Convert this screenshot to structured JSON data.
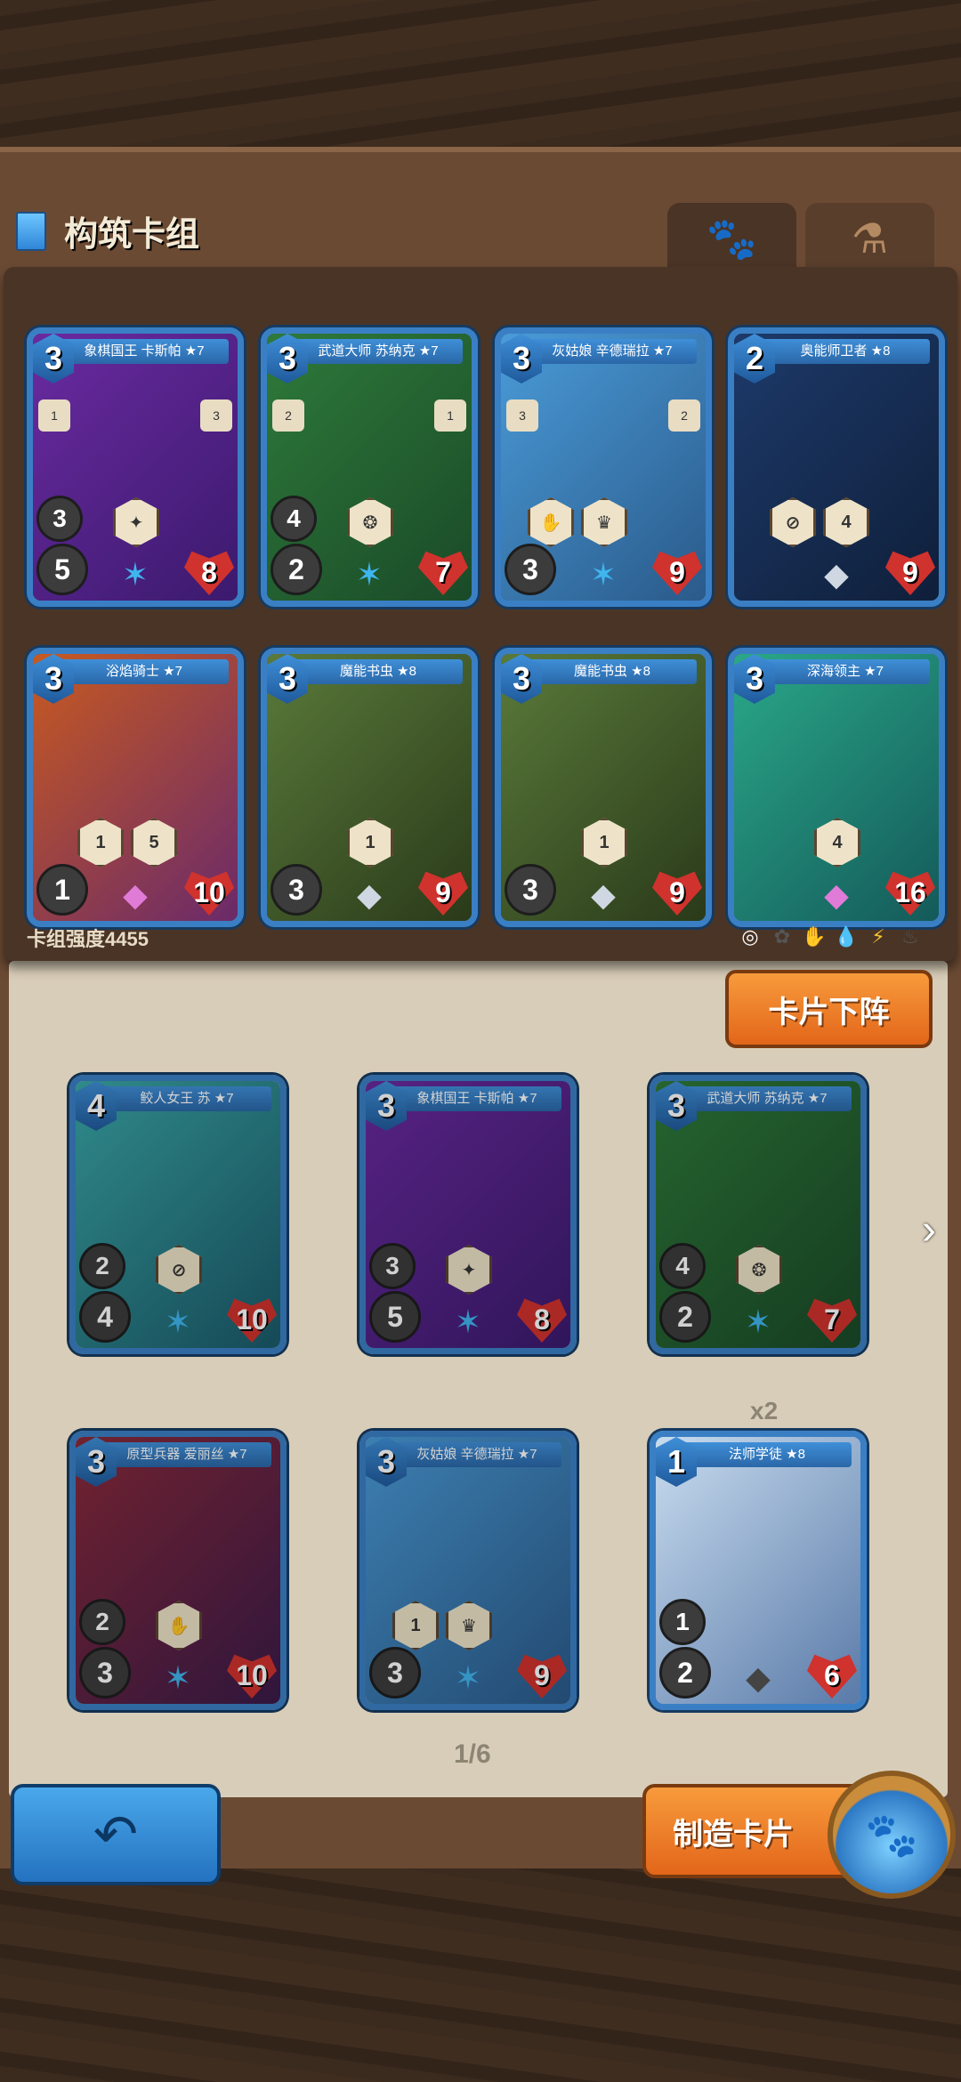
{
  "header": {
    "title": "构筑卡组"
  },
  "tabs": [
    {
      "icon": "paw-icon",
      "symbol": "🐾",
      "active": true
    },
    {
      "icon": "potion-flask-icon",
      "symbol": "⚗",
      "active": false
    }
  ],
  "deck": {
    "strength_label": "卡组强度4455",
    "cards": [
      {
        "name": "象棋国王 卡斯帕 ★7",
        "cost": "3",
        "atk": "5",
        "mid": "3",
        "hp": "8",
        "tl": "1",
        "tr": "3"
      },
      {
        "name": "武道大师 苏纳克 ★7",
        "cost": "3",
        "atk": "2",
        "mid": "4",
        "hp": "7",
        "tl": "2",
        "tr": "1"
      },
      {
        "name": "灰姑娘 辛德瑞拉 ★7",
        "cost": "3",
        "atk": "3",
        "mid": "",
        "hp": "9",
        "tl": "3",
        "tr": "2"
      },
      {
        "name": "奥能师卫者 ★8",
        "cost": "2",
        "atk": "",
        "mid": "",
        "hp": "9",
        "tl": "",
        "tr": ""
      },
      {
        "name": "浴焰骑士 ★7",
        "cost": "3",
        "atk": "1",
        "mid": "",
        "hp": "10",
        "tl": "",
        "tr": ""
      },
      {
        "name": "魔能书虫 ★8",
        "cost": "3",
        "atk": "3",
        "mid": "",
        "hp": "9",
        "tl": "",
        "tr": ""
      },
      {
        "name": "魔能书虫 ★8",
        "cost": "3",
        "atk": "3",
        "mid": "",
        "hp": "9",
        "tl": "",
        "tr": ""
      },
      {
        "name": "深海领主 ★7",
        "cost": "3",
        "atk": "",
        "mid": "",
        "hp": "16",
        "tl": "",
        "tr": ""
      }
    ]
  },
  "buttons": {
    "remove": "卡片下阵",
    "make": "制造卡片",
    "back_icon": "↶"
  },
  "collection": {
    "page": "1/6",
    "x2": "x2",
    "cards": [
      {
        "name": "鲛人女王 苏 ★7",
        "cost": "4",
        "atk": "4",
        "mid": "2",
        "hp": "10"
      },
      {
        "name": "象棋国王 卡斯帕 ★7",
        "cost": "3",
        "atk": "5",
        "mid": "3",
        "hp": "8"
      },
      {
        "name": "武道大师 苏纳克 ★7",
        "cost": "3",
        "atk": "2",
        "mid": "4",
        "hp": "7"
      },
      {
        "name": "原型兵器 爱丽丝 ★7",
        "cost": "3",
        "atk": "3",
        "mid": "2",
        "hp": "10"
      },
      {
        "name": "灰姑娘 辛德瑞拉 ★7",
        "cost": "3",
        "atk": "3",
        "mid": "",
        "hp": "9"
      },
      {
        "name": "法师学徒 ★8",
        "cost": "1",
        "atk": "2",
        "mid": "1",
        "hp": "6"
      }
    ]
  },
  "colors": {
    "accent_orange": "#e3661a",
    "accent_blue": "#2472c0",
    "card_frame": "#3a7fc4"
  }
}
